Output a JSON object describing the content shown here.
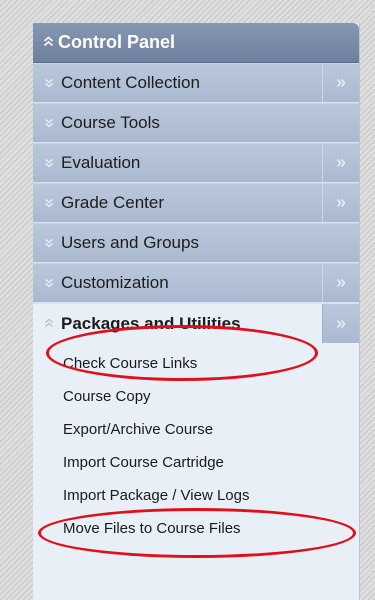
{
  "control_panel": {
    "title": "Control Panel",
    "header_icon": "double-chevron-up-icon",
    "items": [
      {
        "label": "Content Collection",
        "expandable": true
      },
      {
        "label": "Course Tools",
        "expandable": false
      },
      {
        "label": "Evaluation",
        "expandable": true
      },
      {
        "label": "Grade Center",
        "expandable": true
      },
      {
        "label": "Users and Groups",
        "expandable": false
      },
      {
        "label": "Customization",
        "expandable": true
      },
      {
        "label": "Packages and Utilities",
        "expandable": true,
        "expanded": true
      }
    ],
    "submenu": [
      "Check Course Links",
      "Course Copy",
      "Export/Archive Course",
      "Import Course Cartridge",
      "Import Package / View Logs",
      "Move Files to Course Files"
    ],
    "highlight_color": "#e0101a",
    "panel_background": "#e9eff7",
    "header_color": "#6d7f9c"
  }
}
